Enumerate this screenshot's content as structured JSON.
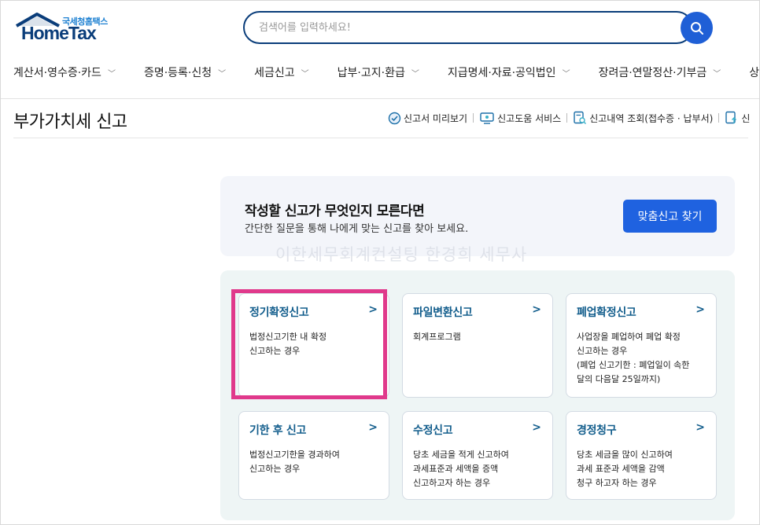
{
  "header": {
    "logo_sub": "국세청홈택스",
    "logo_main": "HomeTax",
    "search_placeholder": "검색어를 입력하세요!",
    "search_icon": "search-icon"
  },
  "gnb": [
    {
      "label": "계산서·영수증·카드"
    },
    {
      "label": "증명·등록·신청"
    },
    {
      "label": "세금신고"
    },
    {
      "label": "납부·고지·환급"
    },
    {
      "label": "지급명세·자료·공익법인"
    },
    {
      "label": "장려금·연말정산·기부금"
    },
    {
      "label": "상담·"
    }
  ],
  "page": {
    "title": "부가가치세 신고",
    "quick_links": [
      {
        "label": "신고서 미리보기",
        "icon": "check-circle-icon"
      },
      {
        "label": "신고도움 서비스",
        "icon": "monitor-icon"
      },
      {
        "label": "신고내역 조회(접수증 · 납부서)",
        "icon": "document-search-icon"
      },
      {
        "label": "신",
        "icon": "document-upload-icon"
      }
    ]
  },
  "banner": {
    "title": "작성할 신고가 무엇인지 모른다면",
    "desc": "간단한 질문을 통해 나에게 맞는 신고를 찾아 보세요.",
    "button": "맞춤신고 찾기"
  },
  "watermark": "이한세무회계컨설팅 한경희 세무사",
  "cards": [
    {
      "title": "정기확정신고",
      "arrow": ">",
      "desc": [
        "법정신고기한 내 확정",
        "신고하는 경우"
      ]
    },
    {
      "title": "파일변환신고",
      "arrow": ">",
      "desc": [
        "회계프로그램"
      ]
    },
    {
      "title": "폐업확정신고",
      "arrow": ">",
      "desc": [
        "사업장을 폐업하여 폐업 확정",
        "신고하는 경우",
        "(폐업 신고기한 : 폐업일이 속한",
        "달의 다음달 25일까지)"
      ]
    },
    {
      "title": "기한 후 신고",
      "arrow": ">",
      "desc": [
        "법정신고기한을 경과하여",
        "신고하는 경우"
      ]
    },
    {
      "title": "수정신고",
      "arrow": ">",
      "desc": [
        "당초 세금을 적게 신고하여",
        "과세표준과 세액을 증액",
        "신고하고자 하는 경우"
      ]
    },
    {
      "title": "경정청구",
      "arrow": ">",
      "desc": [
        "당초 세금을 많이 신고하여",
        "과세 표준과 세액을 감액",
        "청구 하고자 하는 경우"
      ]
    }
  ],
  "colors": {
    "brand_navy": "#0a3d7a",
    "accent_blue": "#1f62e0",
    "card_title": "#125d8c",
    "highlight": "#e0398b"
  }
}
